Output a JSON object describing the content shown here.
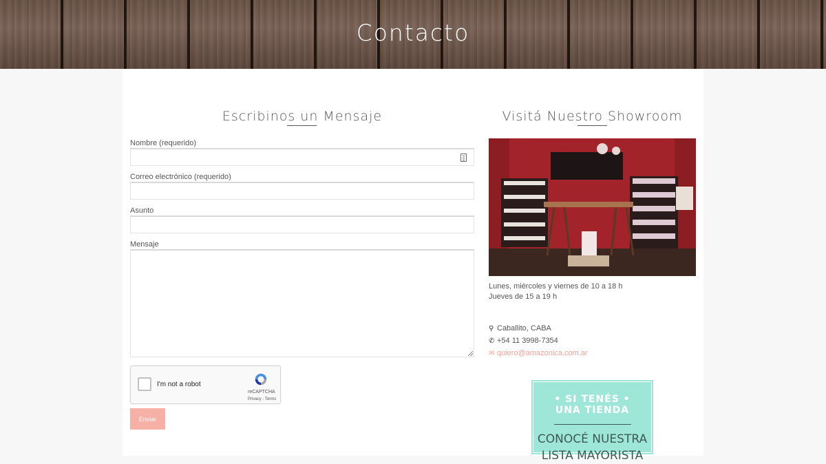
{
  "hero": {
    "title": "Contacto"
  },
  "form_section": {
    "heading": "Escribinos un Mensaje",
    "name_label": "Nombre (requerido)",
    "email_label": "Correo electrónico (requerido)",
    "subject_label": "Asunto",
    "message_label": "Mensaje",
    "captcha": {
      "label": "I'm not a robot",
      "brand": "reCAPTCHA",
      "terms": "Privacy - Terms"
    },
    "submit_label": "Enviar"
  },
  "showroom": {
    "heading": "Visitá Nuestro Showroom",
    "hours_1": "Lunes, miércoles y viernes de 10 a 18 h",
    "hours_2": "Jueves de 15 a 19 h",
    "location": "Caballito, CABA",
    "phone": "+54 11 3998-7354",
    "email": "quiero@amazonica.com.ar",
    "banner": {
      "line_1": "• SI TENÉS •",
      "line_2": "UNA TIENDA",
      "line_3": "CONOCÉ NUESTRA",
      "line_4": "LISTA MAYORISTA"
    }
  },
  "colors": {
    "accent": "#f6b0a6",
    "link": "#f3a296",
    "banner_bg": "#9de6d8"
  },
  "icons": [
    "map-marker-icon",
    "phone-icon",
    "envelope-icon",
    "contact-card-icon",
    "recaptcha-icon"
  ]
}
